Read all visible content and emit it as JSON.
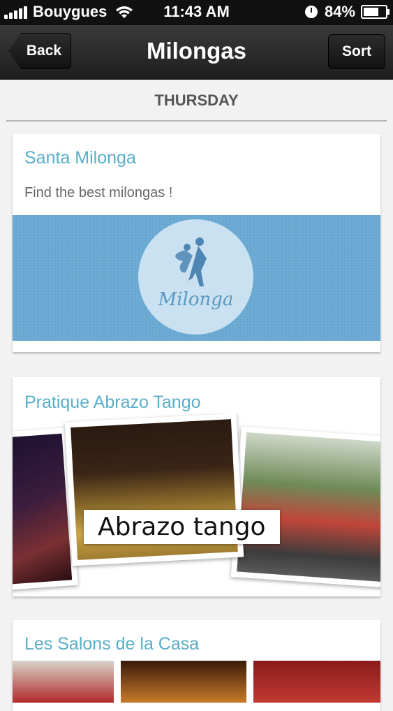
{
  "status_bar": {
    "carrier": "Bouygues",
    "time": "11:43 AM",
    "battery_text": "84%",
    "battery_level": 0.84
  },
  "nav": {
    "back_label": "Back",
    "title": "Milongas",
    "sort_label": "Sort"
  },
  "section": {
    "day": "THURSDAY"
  },
  "cards": [
    {
      "title": "Santa Milonga",
      "description": "Find the best milongas !",
      "logo_text": "Milonga"
    },
    {
      "title": "Pratique Abrazo Tango",
      "caption": "Abrazo tango"
    },
    {
      "title": "Les Salons de la Casa"
    }
  ],
  "colors": {
    "accent": "#5aaec9",
    "banner": "#6aaad5",
    "nav_bg": "#2a2a2a"
  }
}
